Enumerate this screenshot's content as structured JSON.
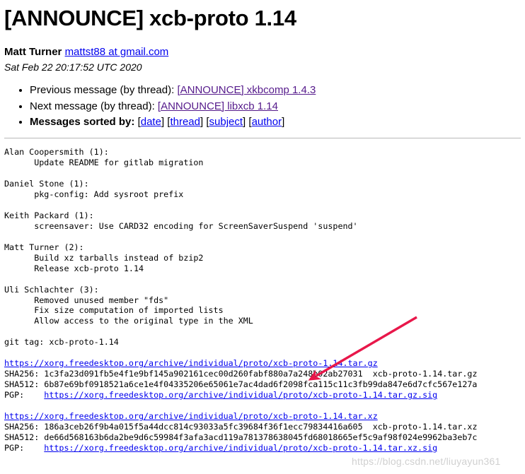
{
  "header": {
    "subject": "[ANNOUNCE] xcb-proto 1.14",
    "author_name": "Matt Turner",
    "author_email": "mattst88 at gmail.com",
    "date": "Sat Feb 22 20:17:52 UTC 2020"
  },
  "nav": {
    "previous_label": "Previous message (by thread): ",
    "previous_link": "[ANNOUNCE] xkbcomp 1.4.3",
    "next_label": "Next message (by thread): ",
    "next_link": "[ANNOUNCE] libxcb 1.14",
    "sorted_label": "Messages sorted by:",
    "sorted_open": "[",
    "sorted_close": "]",
    "sorted": [
      {
        "label": "date"
      },
      {
        "label": "thread"
      },
      {
        "label": "subject"
      },
      {
        "label": "author"
      }
    ]
  },
  "body": {
    "shortlog": "Alan Coopersmith (1):\n      Update README for gitlab migration\n\nDaniel Stone (1):\n      pkg-config: Add sysroot prefix\n\nKeith Packard (1):\n      screensaver: Use CARD32 encoding for ScreenSaverSuspend 'suspend'\n\nMatt Turner (2):\n      Build xz tarballs instead of bzip2\n      Release xcb-proto 1.14\n\nUli Schlachter (3):\n      Removed unused member \"fds\"\n      Fix size computation of imported lists\n      Allow access to the original type in the XML\n\ngit tag: xcb-proto-1.14\n",
    "gz": {
      "url": "https://xorg.freedesktop.org/archive/individual/proto/xcb-proto-1.14.tar.gz",
      "sha256_label": "SHA256: ",
      "sha256": "1c3fa23d091fb5e4f1e9bf145a902161cec00d260fabf880a7a248b02ab27031",
      "sha256_file": "  xcb-proto-1.14.tar.gz",
      "sha512_label": "SHA512: ",
      "sha512": "6b87e69bf0918521a6ce1e4f04335206e65061e7ac4dad6f2098fca115c11c3fb99da847e6d7cfc567e127a",
      "pgp_label": "PGP:    ",
      "pgp_url": "https://xorg.freedesktop.org/archive/individual/proto/xcb-proto-1.14.tar.gz.sig"
    },
    "xz": {
      "url": "https://xorg.freedesktop.org/archive/individual/proto/xcb-proto-1.14.tar.xz",
      "sha256_label": "SHA256: ",
      "sha256": "186a3ceb26f9b4a015f5a44dcc814c93033a5fc39684f36f1ecc79834416a605",
      "sha256_file": "  xcb-proto-1.14.tar.xz",
      "sha512_label": "SHA512: ",
      "sha512": "de66d568163b6da2be9d6c59984f3afa3acd119a781378638045fd68018665ef5c9af98f024e9962ba3eb7c",
      "pgp_label": "PGP:    ",
      "pgp_url": "https://xorg.freedesktop.org/archive/individual/proto/xcb-proto-1.14.tar.xz.sig"
    }
  },
  "annotation": {
    "arrow_color": "#e8174a",
    "watermark": "https://blog.csdn.net/liuyayun361"
  }
}
